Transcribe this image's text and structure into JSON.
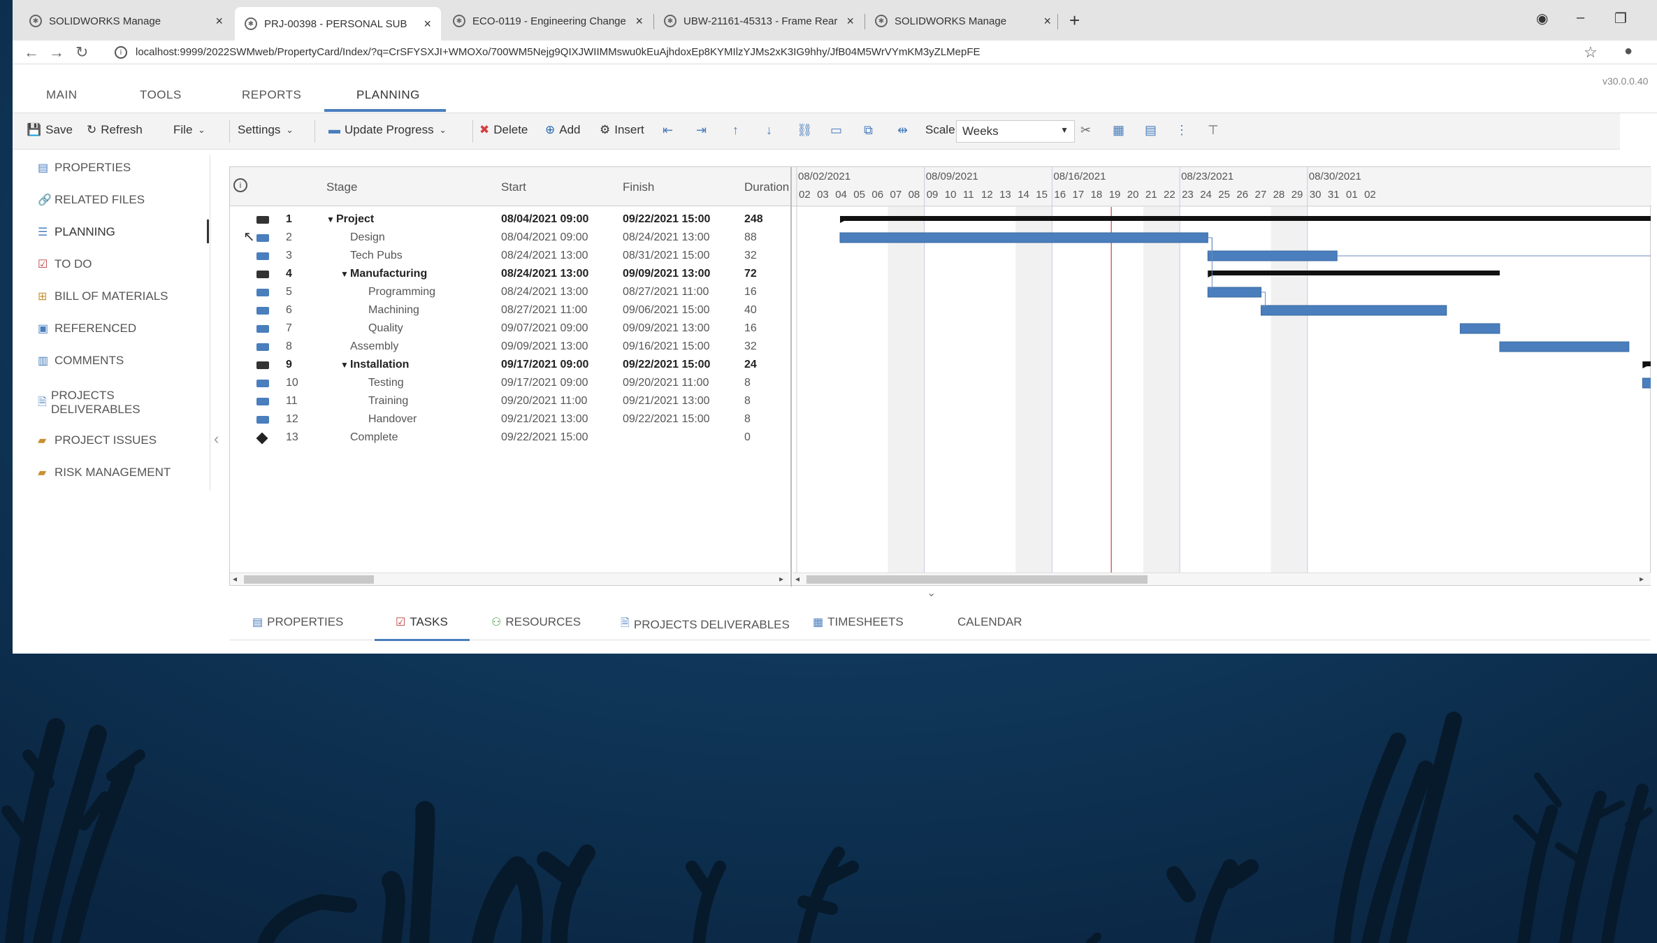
{
  "browser": {
    "tabs": [
      {
        "title": "SOLIDWORKS Manage",
        "active": false
      },
      {
        "title": "PRJ-00398 - PERSONAL SUB",
        "active": true
      },
      {
        "title": "ECO-0119 - Engineering Change",
        "active": false
      },
      {
        "title": "UBW-21161-45313 - Frame Rear",
        "active": false
      },
      {
        "title": "SOLIDWORKS Manage",
        "active": false
      }
    ],
    "new_tab": "+",
    "url": "localhost:9999/2022SWMweb/PropertyCard/Index/?q=CrSFYSXJI+WMOXo/700WM5Nejg9QIXJWIIMMswu0kEuAjhdoxEp8KYMIlzYJMs2xK3IG9hhy/JfB04M5WrVYmKM3yZLMepFE",
    "version": "v30.0.0.40"
  },
  "main_menu": [
    "MAIN",
    "TOOLS",
    "REPORTS",
    "PLANNING"
  ],
  "toolbar": {
    "save": "Save",
    "refresh": "Refresh",
    "file": "File",
    "settings": "Settings",
    "update_progress": "Update Progress",
    "delete": "Delete",
    "add": "Add",
    "insert": "Insert",
    "scale_label": "Scale",
    "scale_value": "Weeks"
  },
  "sidebar": {
    "items": [
      {
        "label": "PROPERTIES"
      },
      {
        "label": "RELATED FILES"
      },
      {
        "label": "PLANNING"
      },
      {
        "label": "TO DO"
      },
      {
        "label": "BILL OF MATERIALS"
      },
      {
        "label": "REFERENCED"
      },
      {
        "label": "COMMENTS"
      },
      {
        "label": "PROJECTS DELIVERABLES"
      },
      {
        "label": "PROJECT ISSUES"
      },
      {
        "label": "RISK MANAGEMENT"
      }
    ]
  },
  "grid": {
    "columns": {
      "stage": "Stage",
      "start": "Start",
      "finish": "Finish",
      "duration": "Duration"
    },
    "rows": [
      {
        "num": "1",
        "stage": "Project",
        "start": "08/04/2021 09:00",
        "finish": "09/22/2021 15:00",
        "duration": "248",
        "type": "summary",
        "level": 0,
        "expander": "▼"
      },
      {
        "num": "2",
        "stage": "Design",
        "start": "08/04/2021 09:00",
        "finish": "08/24/2021 13:00",
        "duration": "88",
        "type": "task",
        "level": 1,
        "expander": ""
      },
      {
        "num": "3",
        "stage": "Tech Pubs",
        "start": "08/24/2021 13:00",
        "finish": "08/31/2021 15:00",
        "duration": "32",
        "type": "task",
        "level": 1,
        "expander": ""
      },
      {
        "num": "4",
        "stage": "Manufacturing",
        "start": "08/24/2021 13:00",
        "finish": "09/09/2021 13:00",
        "duration": "72",
        "type": "summary",
        "level": 1,
        "expander": "▼"
      },
      {
        "num": "5",
        "stage": "Programming",
        "start": "08/24/2021 13:00",
        "finish": "08/27/2021 11:00",
        "duration": "16",
        "type": "task",
        "level": 2,
        "expander": ""
      },
      {
        "num": "6",
        "stage": "Machining",
        "start": "08/27/2021 11:00",
        "finish": "09/06/2021 15:00",
        "duration": "40",
        "type": "task",
        "level": 2,
        "expander": ""
      },
      {
        "num": "7",
        "stage": "Quality",
        "start": "09/07/2021 09:00",
        "finish": "09/09/2021 13:00",
        "duration": "16",
        "type": "task",
        "level": 2,
        "expander": ""
      },
      {
        "num": "8",
        "stage": "Assembly",
        "start": "09/09/2021 13:00",
        "finish": "09/16/2021 15:00",
        "duration": "32",
        "type": "task",
        "level": 1,
        "expander": ""
      },
      {
        "num": "9",
        "stage": "Installation",
        "start": "09/17/2021 09:00",
        "finish": "09/22/2021 15:00",
        "duration": "24",
        "type": "summary",
        "level": 1,
        "expander": "▼"
      },
      {
        "num": "10",
        "stage": "Testing",
        "start": "09/17/2021 09:00",
        "finish": "09/20/2021 11:00",
        "duration": "8",
        "type": "task",
        "level": 2,
        "expander": ""
      },
      {
        "num": "11",
        "stage": "Training",
        "start": "09/20/2021 11:00",
        "finish": "09/21/2021 13:00",
        "duration": "8",
        "type": "task",
        "level": 2,
        "expander": ""
      },
      {
        "num": "12",
        "stage": "Handover",
        "start": "09/21/2021 13:00",
        "finish": "09/22/2021 15:00",
        "duration": "8",
        "type": "task",
        "level": 2,
        "expander": ""
      },
      {
        "num": "13",
        "stage": "Complete",
        "start": "09/22/2021 15:00",
        "finish": "",
        "duration": "0",
        "type": "milestone",
        "level": 1,
        "expander": ""
      }
    ]
  },
  "gantt": {
    "week_labels": [
      "08/02/2021",
      "08/09/2021",
      "08/16/2021",
      "08/23/2021",
      "08/30/2021"
    ],
    "day_labels": [
      "02",
      "03",
      "04",
      "05",
      "06",
      "07",
      "08",
      "09",
      "10",
      "11",
      "12",
      "13",
      "14",
      "15",
      "16",
      "17",
      "18",
      "19",
      "20",
      "21",
      "22",
      "23",
      "24",
      "25",
      "26",
      "27",
      "28",
      "29",
      "30",
      "31",
      "01",
      "02"
    ],
    "today": "08/19/2021",
    "bar_color": "#4a7ebd",
    "summary_color": "#111111",
    "today_color": "#e06060"
  },
  "bottom_tabs": [
    "PROPERTIES",
    "TASKS",
    "RESOURCES",
    "PROJECTS DELIVERABLES",
    "TIMESHEETS",
    "CALENDAR"
  ],
  "active_bottom_tab": "TASKS"
}
